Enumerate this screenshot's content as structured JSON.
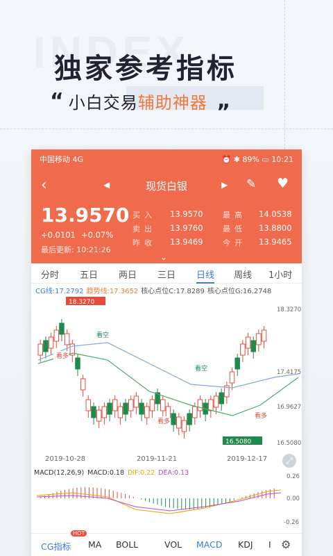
{
  "watermark": "INDEX",
  "headline": "独家参考指标",
  "subline": {
    "open_quote": "“",
    "part1": "小白交易",
    "part2": "辅助神器",
    "close_quote": "„"
  },
  "status": {
    "left": "中国移动 4G",
    "time": "10:21",
    "battery": "89%"
  },
  "nav": {
    "title": "现货白银"
  },
  "quote": {
    "price": "13.9570",
    "change": "+0.0101",
    "change_pct": "+0.07%",
    "update_label": "最后更新:",
    "update_time": "10:21:26",
    "buy_label": "买入",
    "buy": "13.9570",
    "sell_label": "卖出",
    "sell": "13.9760",
    "prev_label": "昨收",
    "prev": "13.9469",
    "high_label": "最高",
    "high": "14.0538",
    "low_label": "最低",
    "low": "13.8800",
    "open_label": "今开",
    "open": "13.9465"
  },
  "tabs": [
    "分时",
    "五日",
    "两日",
    "三日",
    "日线",
    "周线",
    "1小时"
  ],
  "active_tab": "日线",
  "indicators": {
    "cg": "CG线:17.2792",
    "trend": "趋势线:17.3652",
    "core_c": "核心点位C:17.8289",
    "core_g": "核心点位G:16.2748"
  },
  "chart_data": {
    "type": "candlestick",
    "y_ticks": [
      "18.3270",
      "17.4175",
      "16.9627",
      "16.5080"
    ],
    "x_ticks": [
      "2019-10-28",
      "2019-11-21",
      "2019-12-17"
    ],
    "high_marker": "18.3270",
    "low_marker": "16.5080",
    "signals": [
      "看多",
      "看空",
      "看多",
      "看空",
      "看多"
    ]
  },
  "macd": {
    "title": "MACD(12,26,9)",
    "macd": "MACD:0.18",
    "dif": "DIF:0.22",
    "dea": "DEA:0.13",
    "y_ticks": [
      "0.26",
      "0.00",
      "-0.26"
    ]
  },
  "bottom_tabs": [
    "CG指标",
    "MA",
    "BOLL",
    "VOL",
    "MACD",
    "KDJ",
    "I"
  ],
  "hot_badge": "HOT",
  "colors": {
    "accent": "#f06a4c",
    "blue": "#3a7bd5",
    "up": "#e84a3a",
    "down": "#1f8a4c"
  }
}
